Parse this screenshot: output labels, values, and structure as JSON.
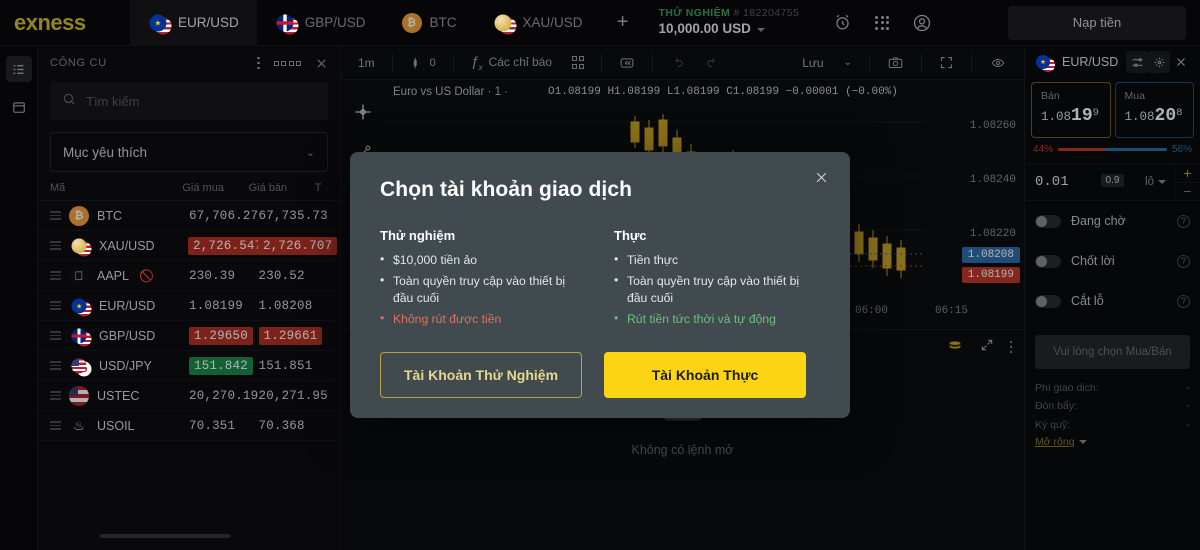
{
  "brand": {
    "name": "exness"
  },
  "topbar": {
    "symbol_tabs": [
      {
        "label": "EUR/USD",
        "icon": "flag-pair-eu-us",
        "active": true
      },
      {
        "label": "GBP/USD",
        "icon": "flag-pair-gb-us",
        "active": false
      },
      {
        "label": "BTC",
        "icon": "bitcoin-icon",
        "active": false
      },
      {
        "label": "XAU/USD",
        "icon": "flag-pair-gold-us",
        "active": false
      }
    ],
    "add_tab_label": "+",
    "account": {
      "type": "THỬ NGHIỆM",
      "number": "# 182204755",
      "balance": "10,000.00 USD"
    },
    "icons": [
      "alarm-clock-icon",
      "apps-grid-icon",
      "user-account-icon"
    ],
    "deposit_label": "Nạp tiền"
  },
  "rail": {
    "items": [
      "list-panel-icon",
      "calendar-icon"
    ]
  },
  "instruments": {
    "title": "CÔNG CỤ",
    "header_actions": [
      "kebab-menu-icon",
      "grid-view-icon",
      "close-icon"
    ],
    "search_placeholder": "Tìm kiếm",
    "favorites_label": "Mục yêu thích",
    "columns": {
      "symbol": "Mã",
      "bid": "Giá mua",
      "ask": "Giá bán",
      "extra": "T"
    },
    "rows": [
      {
        "symbol": "BTC",
        "icon": "bitcoin-icon",
        "bid": "67,706.27",
        "ask": "67,735.73",
        "bid_state": "none",
        "ask_state": "none",
        "disabled": false
      },
      {
        "symbol": "XAU/USD",
        "icon": "flag-pair-gold-us",
        "bid": "2,726.547",
        "ask": "2,726.707",
        "bid_state": "down",
        "ask_state": "down",
        "disabled": false
      },
      {
        "symbol": "AAPL",
        "icon": "apple-icon",
        "bid": "230.39",
        "ask": "230.52",
        "bid_state": "none",
        "ask_state": "none",
        "disabled": true
      },
      {
        "symbol": "EUR/USD",
        "icon": "flag-pair-eu-us",
        "bid": "1.08199",
        "ask": "1.08208",
        "bid_state": "none",
        "ask_state": "none",
        "disabled": false
      },
      {
        "symbol": "GBP/USD",
        "icon": "flag-pair-gb-us",
        "bid": "1.29650",
        "ask": "1.29661",
        "bid_state": "down",
        "ask_state": "down",
        "disabled": false
      },
      {
        "symbol": "USD/JPY",
        "icon": "flag-pair-us-jp",
        "bid": "151.842",
        "ask": "151.851",
        "bid_state": "up",
        "ask_state": "none",
        "disabled": false
      },
      {
        "symbol": "USTEC",
        "icon": "flag-us-index-icon",
        "bid": "20,270.19",
        "ask": "20,271.95",
        "bid_state": "none",
        "ask_state": "none",
        "disabled": false
      },
      {
        "symbol": "USOIL",
        "icon": "oil-drop-icon",
        "bid": "70.351",
        "ask": "70.368",
        "bid_state": "none",
        "ask_state": "none",
        "disabled": false
      }
    ]
  },
  "chart": {
    "toolbar": {
      "timeframe": "1m",
      "candle_style_icon": "candlestick-icon",
      "indicators_label": "Các chỉ báo",
      "indicators_icon": "function-fx-icon",
      "templates_icon": "grid-layout-icon",
      "replay_icon": "replay-icon",
      "undo_icon": "undo-icon",
      "redo_icon": "redo-icon",
      "save_label": "Lưu",
      "save_caret": "chevron-down-icon",
      "camera_icon": "camera-icon",
      "fullscreen_icon": "fullscreen-icon",
      "eye_icon": "eye-icon"
    },
    "left_tools": [
      "crosshair-icon",
      "trendline-icon"
    ],
    "title": "Euro vs US Dollar · 1 ·",
    "ohlc": "O1.08199  H1.08199  L1.08199  C1.08199  −0.00001 (−0.00%)",
    "price_labels": [
      "1.08260",
      "1.08240",
      "1.08220"
    ],
    "bid_tag": "1.08208",
    "ask_tag": "1.08199",
    "time_labels": [
      "06:00",
      "06:15"
    ],
    "clock_icon": "clock-icon"
  },
  "orders": {
    "icons": [
      "money-stack-icon",
      "collapse-icon",
      "kebab-menu-icon"
    ],
    "empty_icon": "empty-folder-icon",
    "empty_text": "Không có lệnh mở"
  },
  "order_panel": {
    "symbol": "EUR/USD",
    "symbol_icon": "flag-pair-eu-us",
    "actions": [
      "settings-sliders-icon",
      "one-click-trade-icon",
      "close-icon"
    ],
    "sell": {
      "label": "Bán",
      "price_prefix": "1.08",
      "price_main": "19",
      "price_sup": "9"
    },
    "buy": {
      "label": "Mua",
      "price_prefix": "1.08",
      "price_main": "20",
      "price_sup": "8"
    },
    "spread": "0.9",
    "ratio_left": "44%",
    "ratio_right": "56%",
    "lot_value": "0.01",
    "lot_unit": "lô",
    "step_plus": "+",
    "step_minus": "−",
    "toggles": [
      {
        "label": "Đang chờ",
        "on": false
      },
      {
        "label": "Chốt lời",
        "on": false
      },
      {
        "label": "Cắt lỗ",
        "on": false
      }
    ],
    "cta_label": "Vui lòng chọn Mua/Bán",
    "info": [
      {
        "label": "Phí giao dịch:",
        "value": "-"
      },
      {
        "label": "Đòn bẩy:",
        "value": "-"
      },
      {
        "label": "Ký quỹ:",
        "value": "-"
      }
    ],
    "expand_label": "Mở rộng"
  },
  "modal": {
    "title": "Chọn tài khoản giao dịch",
    "close_icon": "close-icon",
    "columns": [
      {
        "heading": "Thử nghiệm",
        "items": [
          {
            "text": "$10,000 tiền ảo",
            "tone": "neutral"
          },
          {
            "text": "Toàn quyền truy cập vào thiết bị đầu cuối",
            "tone": "neutral"
          },
          {
            "text": "Không rút được tiền",
            "tone": "negative"
          }
        ],
        "button": "Tài Khoản Thử Nghiệm",
        "button_style": "outline"
      },
      {
        "heading": "Thực",
        "items": [
          {
            "text": "Tiền thực",
            "tone": "neutral"
          },
          {
            "text": "Toàn quyền truy cập vào thiết bị đầu cuối",
            "tone": "neutral"
          },
          {
            "text": "Rút tiền tức thời và tự động",
            "tone": "positive"
          }
        ],
        "button": "Tài Khoản Thực",
        "button_style": "solid"
      }
    ]
  },
  "colors": {
    "brand_yellow": "#d4bf2e",
    "cta_yellow": "#fbd414",
    "up_green": "#1a8a4a",
    "down_red": "#b33127",
    "bid_blue": "#2f6fad",
    "ask_red": "#c0392b",
    "modal_bg": "#414a4f"
  }
}
